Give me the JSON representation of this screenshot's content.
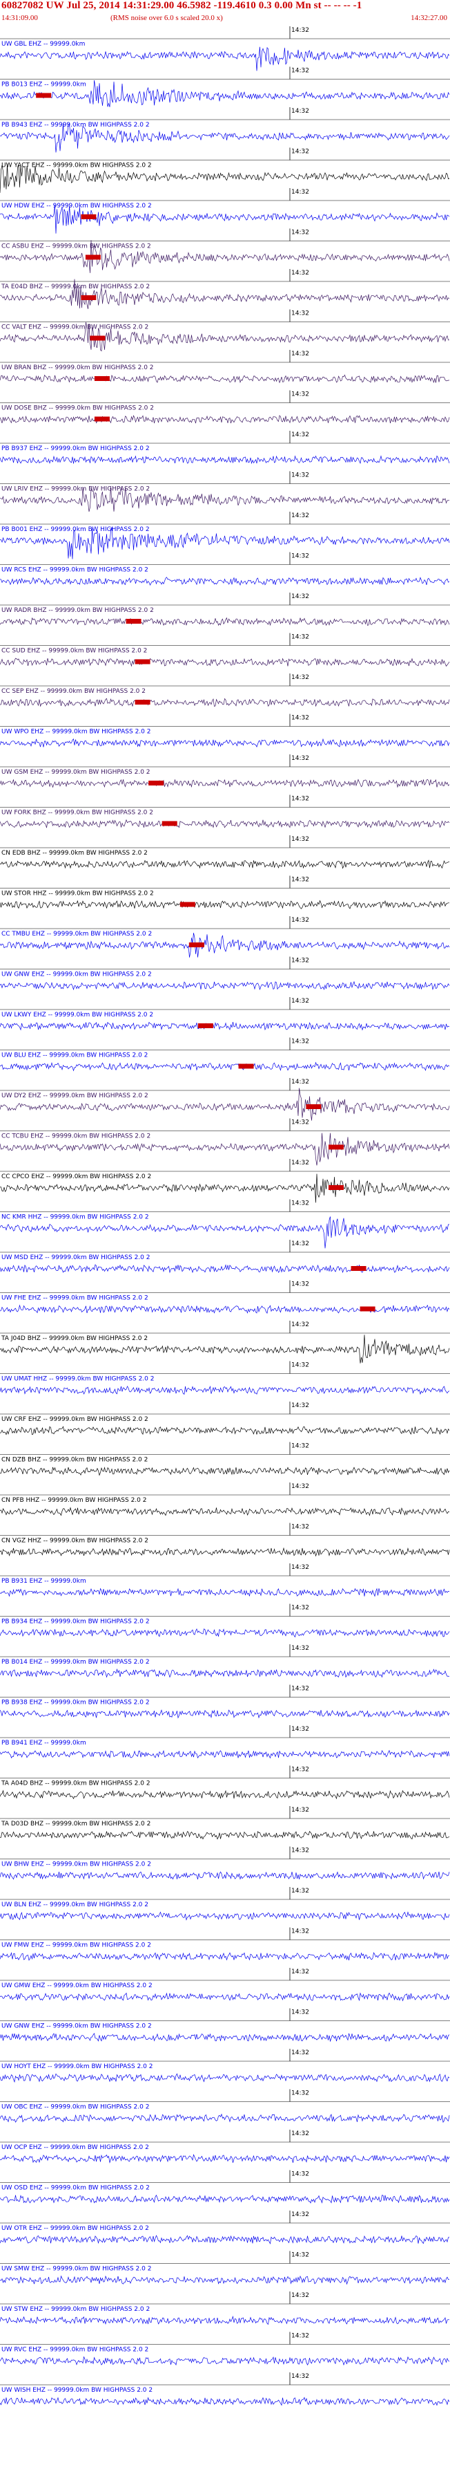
{
  "header": {
    "title": "60827082 UW Jul 25, 2014 14:31:29.00   46.5982 -119.4610  0.3 0.00 Mn st -- -- -- -1",
    "start_time": "14:31:09.00",
    "subtitle": "(RMS noise over 6.0 s scaled 20.0 x)",
    "end_time": "14:32:27.00"
  },
  "time_marker": "14:32",
  "colors": {
    "title": "#cc0000",
    "pick": "#cc0000",
    "blue": "#0000ee",
    "black": "#000000",
    "purple": "#3a1660"
  },
  "traces": [
    {
      "label": "UW GBL EHZ -- 99999.0km",
      "color": "blue",
      "amp": 1.0,
      "pick": null
    },
    {
      "label": "PB B013 EHZ -- 99999.0km",
      "color": "blue",
      "amp": 1.0,
      "pick": 0.08
    },
    {
      "label": "PB B943 EHZ -- 99999.0km BW  HIGHPASS  2.0  2",
      "color": "blue",
      "amp": 1.0,
      "pick": null
    },
    {
      "label": "UW YACT EHZ -- 99999.0km BW  HIGHPASS  2.0  2",
      "color": "black",
      "amp": 1.0,
      "pick": null
    },
    {
      "label": "UW HDW EHZ -- 99999.0km BW  HIGHPASS  2.0  2",
      "color": "blue",
      "amp": 1.0,
      "pick": 0.18
    },
    {
      "label": "CC ASBU EHZ -- 99999.0km BW  HIGHPASS  2.0  2",
      "color": "purple",
      "amp": 1.0,
      "pick": 0.19
    },
    {
      "label": "TA E04D BHZ -- 99999.0km BW  HIGHPASS  2.0  2",
      "color": "purple",
      "amp": 1.0,
      "pick": 0.18
    },
    {
      "label": "CC VALT EHZ -- 99999.0km BW  HIGHPASS  2.0  2",
      "color": "purple",
      "amp": 1.0,
      "pick": 0.2
    },
    {
      "label": "UW BRAN BHZ -- 99999.0km BW  HIGHPASS  2.0  2",
      "color": "purple",
      "amp": 1.0,
      "pick": 0.21
    },
    {
      "label": "UW DOSE BHZ -- 99999.0km BW  HIGHPASS  2.0  2",
      "color": "purple",
      "amp": 1.0,
      "pick": 0.21
    },
    {
      "label": "PB B937 EHZ -- 99999.0km BW  HIGHPASS  2.0  2",
      "color": "blue",
      "amp": 1.0,
      "pick": null
    },
    {
      "label": "UW LRIV EHZ -- 99999.0km BW  HIGHPASS  2.0  2",
      "color": "purple",
      "amp": 1.0,
      "pick": null
    },
    {
      "label": "PB B001 EHZ -- 99999.0km BW  HIGHPASS  2.0  2",
      "color": "blue",
      "amp": 1.0,
      "pick": null
    },
    {
      "label": "UW RCS EHZ -- 99999.0km BW  HIGHPASS  2.0  2",
      "color": "blue",
      "amp": 1.0,
      "pick": null
    },
    {
      "label": "UW RADR BHZ -- 99999.0km BW  HIGHPASS  2.0  2",
      "color": "purple",
      "amp": 1.0,
      "pick": 0.28
    },
    {
      "label": "CC SUD EHZ -- 99999.0km BW  HIGHPASS  2.0  2",
      "color": "purple",
      "amp": 1.0,
      "pick": 0.3
    },
    {
      "label": "CC SEP EHZ -- 99999.0km BW  HIGHPASS  2.0  2",
      "color": "purple",
      "amp": 1.0,
      "pick": 0.3
    },
    {
      "label": "UW WPO EHZ -- 99999.0km BW  HIGHPASS  2.0  2",
      "color": "blue",
      "amp": 1.0,
      "pick": null
    },
    {
      "label": "UW GSM EHZ -- 99999.0km BW  HIGHPASS  2.0  2",
      "color": "purple",
      "amp": 1.0,
      "pick": 0.33
    },
    {
      "label": "UW FORK BHZ -- 99999.0km BW  HIGHPASS  2.0  2",
      "color": "purple",
      "amp": 1.0,
      "pick": 0.36
    },
    {
      "label": "CN EDB BHZ -- 99999.0km BW  HIGHPASS  2.0  2",
      "color": "black",
      "amp": 1.0,
      "pick": null
    },
    {
      "label": "UW STOR HHZ -- 99999.0km BW  HIGHPASS  2.0  2",
      "color": "black",
      "amp": 1.0,
      "pick": 0.4
    },
    {
      "label": "CC TMBU EHZ -- 99999.0km BW  HIGHPASS  2.0  2",
      "color": "blue",
      "amp": 1.0,
      "pick": 0.42
    },
    {
      "label": "UW GNW EHZ -- 99999.0km BW  HIGHPASS  2.0  2",
      "color": "blue",
      "amp": 1.0,
      "pick": null
    },
    {
      "label": "UW LKWY EHZ -- 99999.0km BW  HIGHPASS  2.0  2",
      "color": "blue",
      "amp": 1.0,
      "pick": 0.44
    },
    {
      "label": "UW BLU EHZ -- 99999.0km BW  HIGHPASS  2.0  2",
      "color": "blue",
      "amp": 1.0,
      "pick": 0.53
    },
    {
      "label": "UW DY2 EHZ -- 99999.0km BW  HIGHPASS  2.0  2",
      "color": "purple",
      "amp": 1.0,
      "pick": 0.68
    },
    {
      "label": "CC TCBU EHZ -- 99999.0km BW  HIGHPASS  2.0  2",
      "color": "purple",
      "amp": 1.0,
      "pick": 0.73
    },
    {
      "label": "CC CPCO EHZ -- 99999.0km BW  HIGHPASS  2.0  2",
      "color": "black",
      "amp": 1.0,
      "pick": 0.73
    },
    {
      "label": "NC KMR HHZ -- 99999.0km BW  HIGHPASS  2.0  2",
      "color": "blue",
      "amp": 1.0,
      "pick": null
    },
    {
      "label": "UW MSD EHZ -- 99999.0km BW  HIGHPASS  2.0  2",
      "color": "blue",
      "amp": 1.0,
      "pick": 0.78
    },
    {
      "label": "UW FHE EHZ -- 99999.0km BW  HIGHPASS  2.0  2",
      "color": "blue",
      "amp": 1.0,
      "pick": 0.8
    },
    {
      "label": "TA J04D BHZ -- 99999.0km BW  HIGHPASS  2.0  2",
      "color": "black",
      "amp": 1.0,
      "pick": null
    },
    {
      "label": "UW UMAT HHZ -- 99999.0km BW  HIGHPASS  2.0  2",
      "color": "blue",
      "amp": 1.0,
      "pick": null
    },
    {
      "label": "UW CRF EHZ -- 99999.0km BW  HIGHPASS  2.0  2",
      "color": "black",
      "amp": 1.0,
      "pick": null
    },
    {
      "label": "CN DZB BHZ -- 99999.0km BW  HIGHPASS  2.0  2",
      "color": "black",
      "amp": 1.0,
      "pick": null
    },
    {
      "label": "CN PFB HHZ -- 99999.0km BW  HIGHPASS  2.0  2",
      "color": "black",
      "amp": 1.0,
      "pick": null
    },
    {
      "label": "CN VGZ HHZ -- 99999.0km BW  HIGHPASS  2.0  2",
      "color": "black",
      "amp": 1.0,
      "pick": null
    },
    {
      "label": "PB B931 EHZ -- 99999.0km",
      "color": "blue",
      "amp": 1.0,
      "pick": null
    },
    {
      "label": "PB B934 EHZ -- 99999.0km BW  HIGHPASS  2.0  2",
      "color": "blue",
      "amp": 1.0,
      "pick": null
    },
    {
      "label": "PB B014 EHZ -- 99999.0km BW  HIGHPASS  2.0  2",
      "color": "blue",
      "amp": 1.0,
      "pick": null
    },
    {
      "label": "PB B938 EHZ -- 99999.0km BW  HIGHPASS  2.0  2",
      "color": "blue",
      "amp": 1.0,
      "pick": null
    },
    {
      "label": "PB B941 EHZ -- 99999.0km",
      "color": "blue",
      "amp": 1.0,
      "pick": null
    },
    {
      "label": "TA A04D BHZ -- 99999.0km BW  HIGHPASS  2.0  2",
      "color": "black",
      "amp": 1.0,
      "pick": null
    },
    {
      "label": "TA D03D BHZ -- 99999.0km BW  HIGHPASS  2.0  2",
      "color": "black",
      "amp": 1.0,
      "pick": null
    },
    {
      "label": "UW BHW EHZ -- 99999.0km BW  HIGHPASS  2.0  2",
      "color": "blue",
      "amp": 1.0,
      "pick": null
    },
    {
      "label": "UW BLN EHZ -- 99999.0km BW  HIGHPASS  2.0  2",
      "color": "blue",
      "amp": 1.0,
      "pick": null
    },
    {
      "label": "UW FMW EHZ -- 99999.0km BW  HIGHPASS  2.0  2",
      "color": "blue",
      "amp": 1.0,
      "pick": null
    },
    {
      "label": "UW GMW EHZ -- 99999.0km BW  HIGHPASS  2.0  2",
      "color": "blue",
      "amp": 1.0,
      "pick": null
    },
    {
      "label": "UW GNW EHZ -- 99999.0km BW  HIGHPASS  2.0  2",
      "color": "blue",
      "amp": 1.0,
      "pick": null
    },
    {
      "label": "UW HOYT EHZ -- 99999.0km BW  HIGHPASS  2.0  2",
      "color": "blue",
      "amp": 1.0,
      "pick": null
    },
    {
      "label": "UW OBC EHZ -- 99999.0km BW  HIGHPASS  2.0  2",
      "color": "blue",
      "amp": 1.0,
      "pick": null
    },
    {
      "label": "UW OCP EHZ -- 99999.0km BW  HIGHPASS  2.0  2",
      "color": "blue",
      "amp": 1.0,
      "pick": null
    },
    {
      "label": "UW OSD EHZ -- 99999.0km BW  HIGHPASS  2.0  2",
      "color": "blue",
      "amp": 1.0,
      "pick": null
    },
    {
      "label": "UW OTR EHZ -- 99999.0km BW  HIGHPASS  2.0  2",
      "color": "blue",
      "amp": 1.0,
      "pick": null
    },
    {
      "label": "UW SMW EHZ -- 99999.0km BW  HIGHPASS  2.0  2",
      "color": "blue",
      "amp": 1.0,
      "pick": null
    },
    {
      "label": "UW STW EHZ -- 99999.0km BW  HIGHPASS  2.0  2",
      "color": "blue",
      "amp": 1.0,
      "pick": null
    },
    {
      "label": "UW RVC EHZ -- 99999.0km BW  HIGHPASS  2.0  2",
      "color": "blue",
      "amp": 1.0,
      "pick": null
    },
    {
      "label": "UW WISH EHZ -- 99999.0km BW  HIGHPASS  2.0  2",
      "color": "blue",
      "amp": 1.0,
      "pick": null
    }
  ]
}
